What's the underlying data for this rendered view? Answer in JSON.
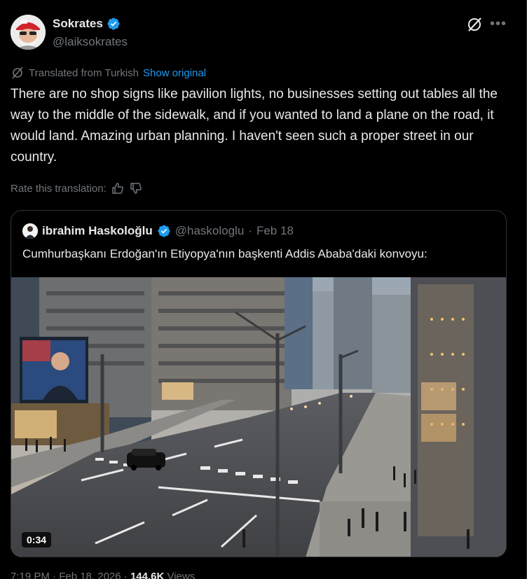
{
  "author": {
    "display_name": "Sokrates",
    "handle": "@laiksokrates",
    "verified_icon": "verified-badge-icon"
  },
  "translation": {
    "label": "Translated from Turkish",
    "show_original": "Show original"
  },
  "tweet_text": "There are no shop signs like pavilion lights, no businesses setting out tables all the way to the middle of the sidewalk, and if you wanted to land a plane on the road, it would land. Amazing urban planning. I haven't seen such a proper street in our country.",
  "rate": {
    "label": "Rate this translation:"
  },
  "quote": {
    "name": "ibrahim Haskoloğlu",
    "handle": "@haskologlu",
    "dot": "·",
    "date": "Feb 18",
    "text": "Cumhurbaşkanı Erdoğan'ın Etiyopya'nın başkenti Addis Ababa'daki konvoyu:",
    "video_duration": "0:34"
  },
  "meta": {
    "time": "7:19 PM · Feb 18, 2026 · ",
    "views_count": "144.6K",
    "views_label": " Views"
  },
  "colors": {
    "accent": "#1d9bf0",
    "secondary_text": "#71767b",
    "border": "#2f3336",
    "background": "#000000"
  }
}
